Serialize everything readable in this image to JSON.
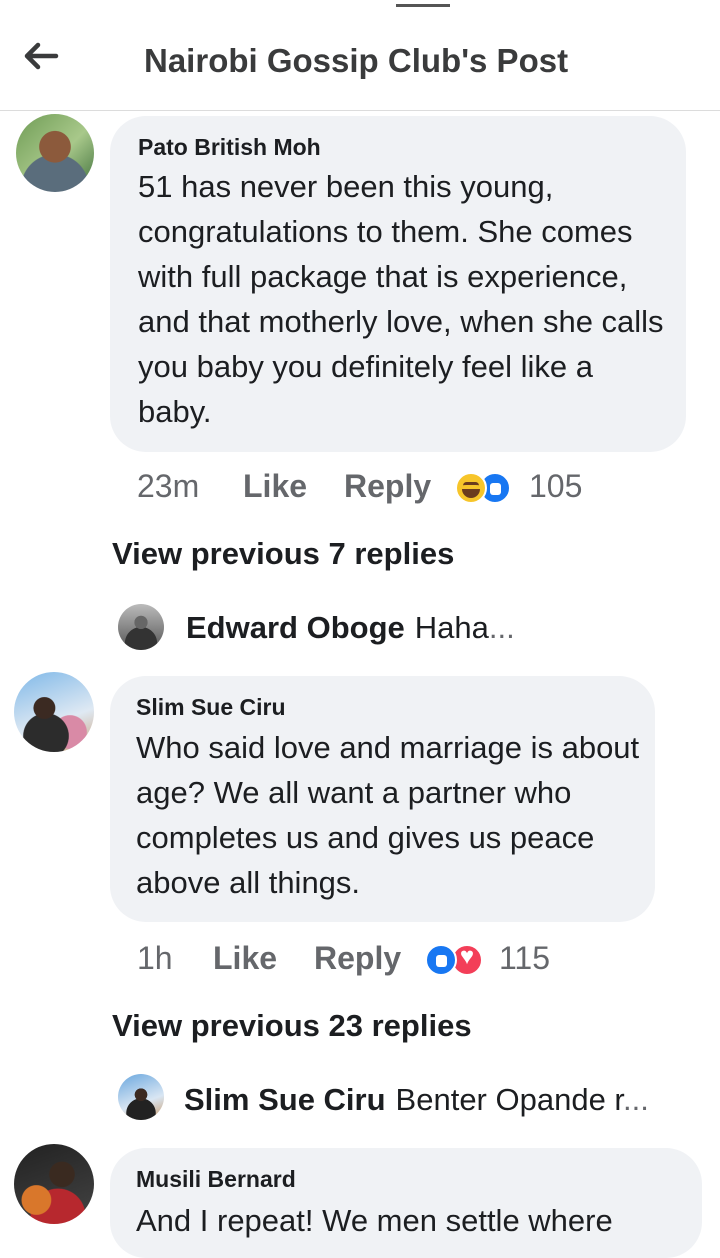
{
  "header": {
    "title": "Nairobi Gossip Club's Post"
  },
  "comments": [
    {
      "author": "Pato British Moh",
      "text": "51 has never been this young, congratulations to them. She comes with full package that is experience, and that motherly love, when she calls you baby you definitely feel like a baby.",
      "time": "23m",
      "like_label": "Like",
      "reply_label": "Reply",
      "reactions": [
        "haha",
        "like"
      ],
      "reaction_count": "105",
      "view_previous": "View previous 7 replies",
      "reply_preview": {
        "author": "Edward Oboge",
        "text": "Haha",
        "ellipsis": "..."
      }
    },
    {
      "author": "Slim Sue Ciru",
      "text": "Who said love and marriage  is about age? We all want a partner who completes us and gives us peace above all things.",
      "time": "1h",
      "like_label": "Like",
      "reply_label": "Reply",
      "reactions": [
        "like",
        "love"
      ],
      "reaction_count": "115",
      "view_previous": "View previous 23 replies",
      "reply_preview": {
        "author": "Slim Sue Ciru",
        "text": "Benter Opande r",
        "ellipsis": "..."
      }
    },
    {
      "author": "Musili Bernard",
      "text": "And I repeat! We men settle where"
    }
  ]
}
